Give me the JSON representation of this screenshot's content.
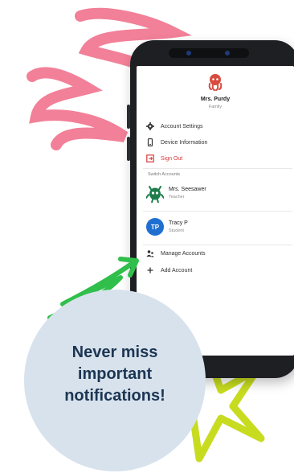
{
  "profile": {
    "name": "Mrs. Purdy",
    "role": "Family"
  },
  "menu": {
    "account_settings": "Account Settings",
    "device_information": "Device Information",
    "sign_out": "Sign Out"
  },
  "switch_accounts_label": "Switch Accounts",
  "accounts": [
    {
      "name": "Mrs. Seesawer",
      "role": "Teacher"
    },
    {
      "name": "Tracy P",
      "role": "Student",
      "initials": "TP"
    }
  ],
  "actions": {
    "manage_accounts": "Manage Accounts",
    "add_account": "Add Account"
  },
  "tagline": [
    "Never miss",
    "important",
    "notifications!"
  ],
  "colors": {
    "sign_out": "#d63a3a",
    "avatar_blue": "#1f6fd1",
    "tagline_text": "#1c3553",
    "circle_bg": "#d7e2ec",
    "pink_scribble": "#f06a86",
    "green_arrow": "#2fbf4a",
    "lime_star": "#c7dc1f"
  }
}
